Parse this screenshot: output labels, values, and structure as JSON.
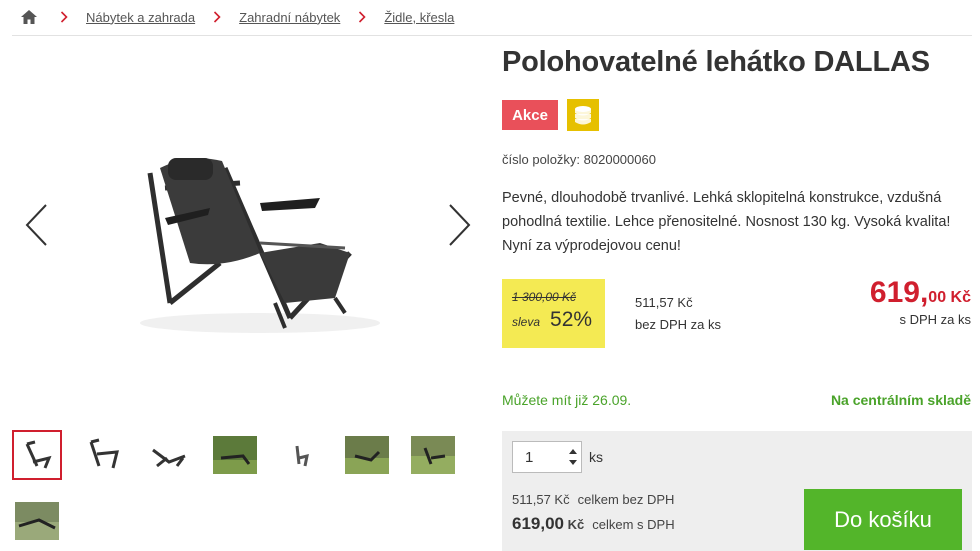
{
  "breadcrumb": {
    "home_icon": "home-icon",
    "items": [
      "Nábytek a zahrada",
      "Zahradní nábytek",
      "Židle, křesla"
    ]
  },
  "product": {
    "title": "Polohovatelné lehátko DALLAS",
    "badge_akce": "Akce",
    "badge_coins_icon": "coins-icon",
    "sku_label": "číslo položky: 8020000060",
    "description": "Pevné, dlouhodobě trvanlivé. Lehká sklopitelná konstrukce, vzdušná pohodlná textilie. Lehce přenositelné. Nosnost 130 kg. Vysoká kvalita! Nyní za výprodejovou cenu!"
  },
  "pricing": {
    "old_price": "1 300,00 Kč",
    "sleva_label": "sleva",
    "sleva_pct": "52",
    "sleva_pct_sign": "%",
    "net_price": "511,57 Kč",
    "net_label": "bez DPH za ks",
    "gross_int": "619,",
    "gross_dec": "00 Kč",
    "gross_label": "s DPH za ks"
  },
  "availability": {
    "delivery": "Můžete mít již 26.09.",
    "stock": "Na centrálním skladě"
  },
  "cart": {
    "qty_value": "1",
    "qty_unit": "ks",
    "total_net_value": "511,57 Kč",
    "total_net_label": "celkem bez DPH",
    "total_gross_value": "619,00",
    "total_gross_currency": "Kč",
    "total_gross_label": "celkem s DPH",
    "button_label": "Do košíku"
  },
  "colors": {
    "accent_red": "#d01f2e",
    "badge_red": "#e9505a",
    "discount_yellow": "#f4ea53",
    "coins_gold": "#e6c000",
    "green": "#53b52a",
    "text_green": "#4aa32a"
  },
  "gallery": {
    "thumbnail_count": 8,
    "active_index": 0
  }
}
